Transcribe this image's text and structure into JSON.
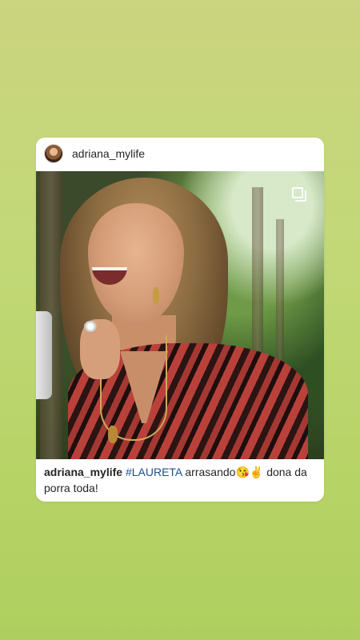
{
  "post": {
    "username": "adriana_mylife",
    "caption": {
      "username": "adriana_mylife",
      "hashtag": "#LAURETA",
      "text_before_emoji": "arrasando",
      "emojis": "😘✌",
      "text_after_emoji": "dona da porra toda!"
    },
    "photo": {
      "icon": "multiple-photos-icon"
    }
  },
  "colors": {
    "background_top": "#cbd47e",
    "background_bottom": "#aecf5f",
    "card": "#ffffff",
    "text": "#262626",
    "hashtag": "#1d4e89"
  }
}
